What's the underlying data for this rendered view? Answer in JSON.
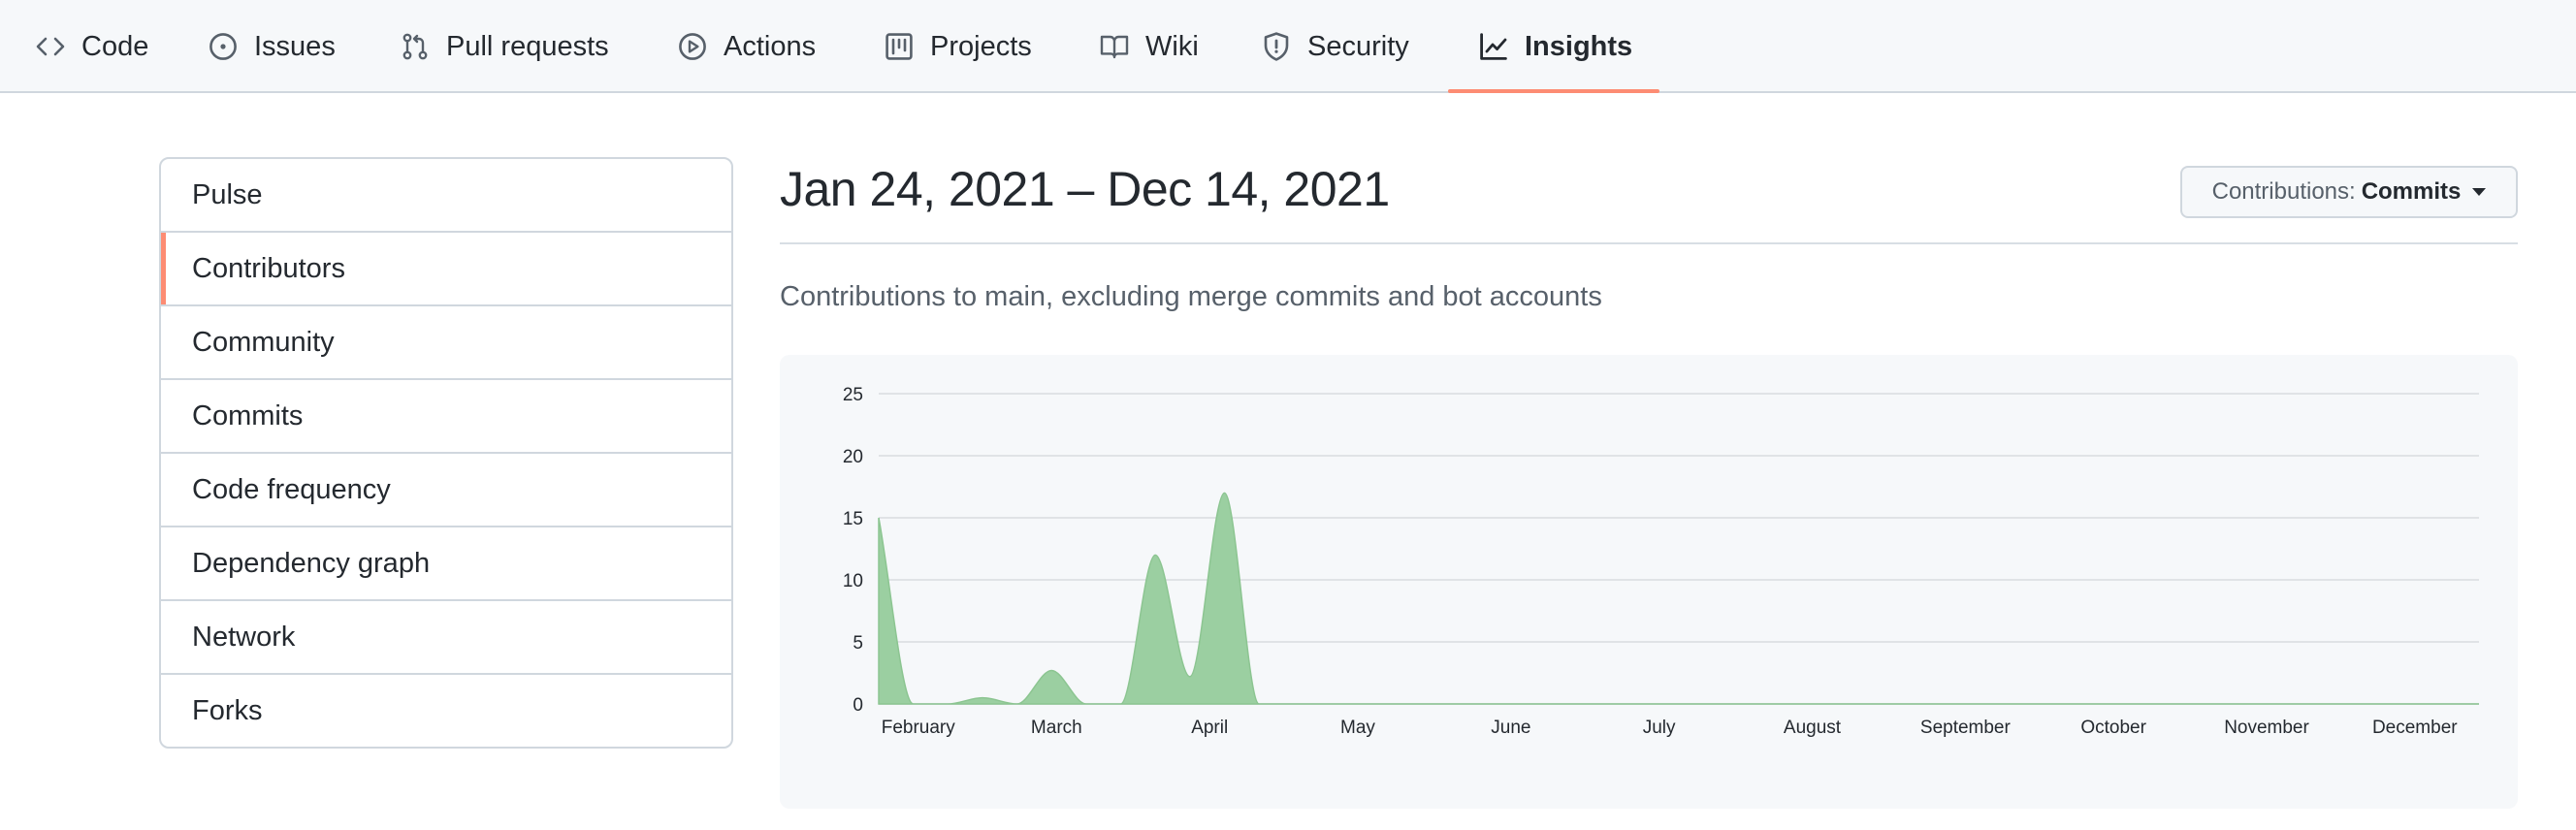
{
  "tabs": [
    {
      "label": "Code",
      "icon": "code-icon"
    },
    {
      "label": "Issues",
      "icon": "issue-opened-icon"
    },
    {
      "label": "Pull requests",
      "icon": "git-pull-request-icon"
    },
    {
      "label": "Actions",
      "icon": "play-icon"
    },
    {
      "label": "Projects",
      "icon": "project-icon"
    },
    {
      "label": "Wiki",
      "icon": "book-icon"
    },
    {
      "label": "Security",
      "icon": "shield-icon"
    },
    {
      "label": "Insights",
      "icon": "graph-icon",
      "active": true
    }
  ],
  "sidebar": {
    "items": [
      {
        "label": "Pulse"
      },
      {
        "label": "Contributors",
        "selected": true
      },
      {
        "label": "Community"
      },
      {
        "label": "Commits"
      },
      {
        "label": "Code frequency"
      },
      {
        "label": "Dependency graph"
      },
      {
        "label": "Network"
      },
      {
        "label": "Forks"
      }
    ]
  },
  "main": {
    "date_range": "Jan 24, 2021 – Dec 14, 2021",
    "contributions_button": {
      "prefix": "Contributions:",
      "value": "Commits"
    },
    "subtitle": "Contributions to main, excluding merge commits and bot accounts"
  },
  "colors": {
    "accent": "#fd8c73",
    "area_fill": "#9bcfa1",
    "area_stroke": "#8cc591"
  },
  "chart_data": {
    "type": "area",
    "x_ticks": [
      "February",
      "March",
      "April",
      "May",
      "June",
      "July",
      "August",
      "September",
      "October",
      "November",
      "December"
    ],
    "y_ticks": [
      0,
      5,
      10,
      15,
      20,
      25
    ],
    "ylim": [
      0,
      25
    ],
    "xlim": [
      "2021-01-24",
      "2021-12-14"
    ],
    "grid": true,
    "x": [
      "2021-01-24",
      "2021-01-31",
      "2021-02-07",
      "2021-02-14",
      "2021-02-21",
      "2021-02-28",
      "2021-03-07",
      "2021-03-14",
      "2021-03-21",
      "2021-03-28",
      "2021-04-04",
      "2021-04-11",
      "2021-04-18",
      "2021-04-25",
      "2021-05-02",
      "2021-05-09",
      "2021-05-16",
      "2021-05-23",
      "2021-05-30",
      "2021-12-14"
    ],
    "values": [
      15,
      0,
      0,
      0.5,
      0,
      2.7,
      0,
      0,
      12,
      2.2,
      17,
      0,
      0,
      0,
      0,
      0,
      0,
      0,
      0,
      0
    ]
  }
}
